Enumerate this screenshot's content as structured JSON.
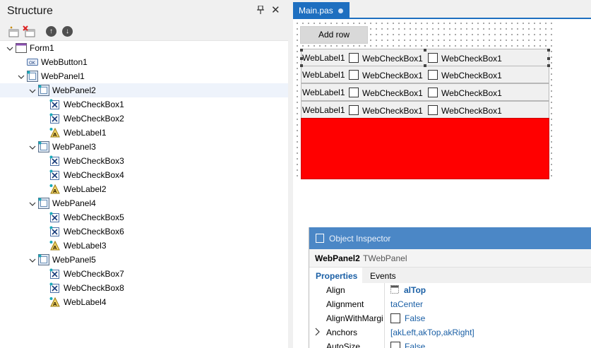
{
  "structure": {
    "title": "Structure",
    "pin_glyph": "📌",
    "close_glyph": "✕",
    "tools": {
      "new_icon": "new-item-icon",
      "delete_icon": "delete-item-icon",
      "up_glyph": "↑",
      "down_glyph": "↓"
    },
    "tree": [
      {
        "label": "Form1",
        "icon": "form-icon",
        "expanded": true
      },
      {
        "label": "WebButton1",
        "icon": "button-icon"
      },
      {
        "label": "WebPanel1",
        "icon": "panel-icon"
      },
      {
        "label": "WebPanel2",
        "icon": "panel-icon",
        "expanded": true,
        "selected": true
      },
      {
        "label": "WebCheckBox1",
        "icon": "checkbox-icon"
      },
      {
        "label": "WebCheckBox2",
        "icon": "checkbox-icon"
      },
      {
        "label": "WebLabel1",
        "icon": "label-icon"
      },
      {
        "label": "WebPanel3",
        "icon": "panel-icon",
        "expanded": true
      },
      {
        "label": "WebCheckBox3",
        "icon": "checkbox-icon"
      },
      {
        "label": "WebCheckBox4",
        "icon": "checkbox-icon"
      },
      {
        "label": "WebLabel2",
        "icon": "label-icon"
      },
      {
        "label": "WebPanel4",
        "icon": "panel-icon",
        "expanded": true
      },
      {
        "label": "WebCheckBox5",
        "icon": "checkbox-icon"
      },
      {
        "label": "WebCheckBox6",
        "icon": "checkbox-icon"
      },
      {
        "label": "WebLabel3",
        "icon": "label-icon"
      },
      {
        "label": "WebPanel5",
        "icon": "panel-icon",
        "expanded": true
      },
      {
        "label": "WebCheckBox7",
        "icon": "checkbox-icon"
      },
      {
        "label": "WebCheckBox8",
        "icon": "checkbox-icon"
      },
      {
        "label": "WebLabel4",
        "icon": "label-icon"
      }
    ]
  },
  "designer": {
    "tab_label": "Main.pas",
    "add_row_label": "Add row",
    "rows": [
      {
        "label": "WebLabel1",
        "check1": "WebCheckBox1",
        "check2": "WebCheckBox1"
      },
      {
        "label": "WebLabel1",
        "check1": "WebCheckBox1",
        "check2": "WebCheckBox1"
      },
      {
        "label": "WebLabel1",
        "check1": "WebCheckBox1",
        "check2": "WebCheckBox1"
      },
      {
        "label": "WebLabel1",
        "check1": "WebCheckBox1",
        "check2": "WebCheckBox1"
      }
    ],
    "red_panel_color": "#ff0000"
  },
  "inspector": {
    "title": "Object Inspector",
    "object_name": "WebPanel2",
    "object_class": "TWebPanel",
    "tab_properties": "Properties",
    "tab_events": "Events",
    "properties": [
      {
        "name": "Align",
        "value": "alTop"
      },
      {
        "name": "Alignment",
        "value": "taCenter"
      },
      {
        "name": "AlignWithMargins",
        "value": "False"
      },
      {
        "name": "Anchors",
        "value": "[akLeft,akTop,akRight]"
      },
      {
        "name": "AutoSize",
        "value": "False"
      }
    ]
  },
  "colors": {
    "accent": "#1e6fc0",
    "inspector_caption": "#4b87c6",
    "value_text": "#1a5fa5"
  }
}
